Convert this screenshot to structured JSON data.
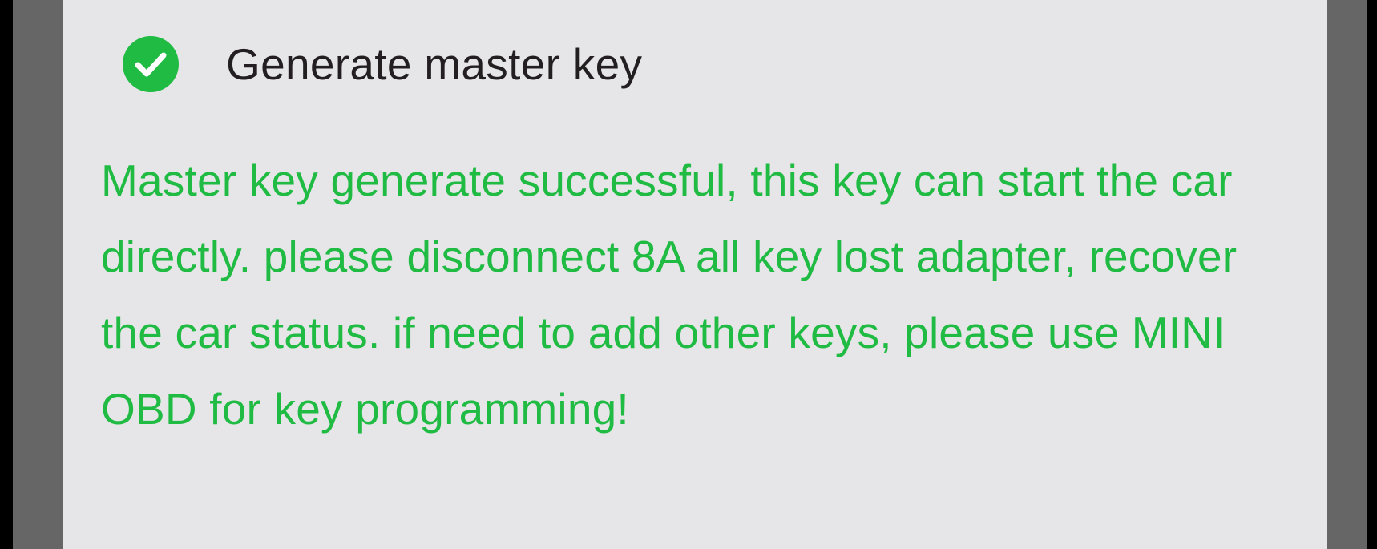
{
  "step": {
    "icon": "check-circle-icon",
    "status_color": "#1fbb43",
    "title": "Generate master key"
  },
  "result": {
    "color": "#1fbb43",
    "message": "Master key generate successful, this key can start the car directly. please disconnect 8A all key lost adapter, recover the car status. if need to add other keys, please use MINI OBD for key programming!"
  }
}
